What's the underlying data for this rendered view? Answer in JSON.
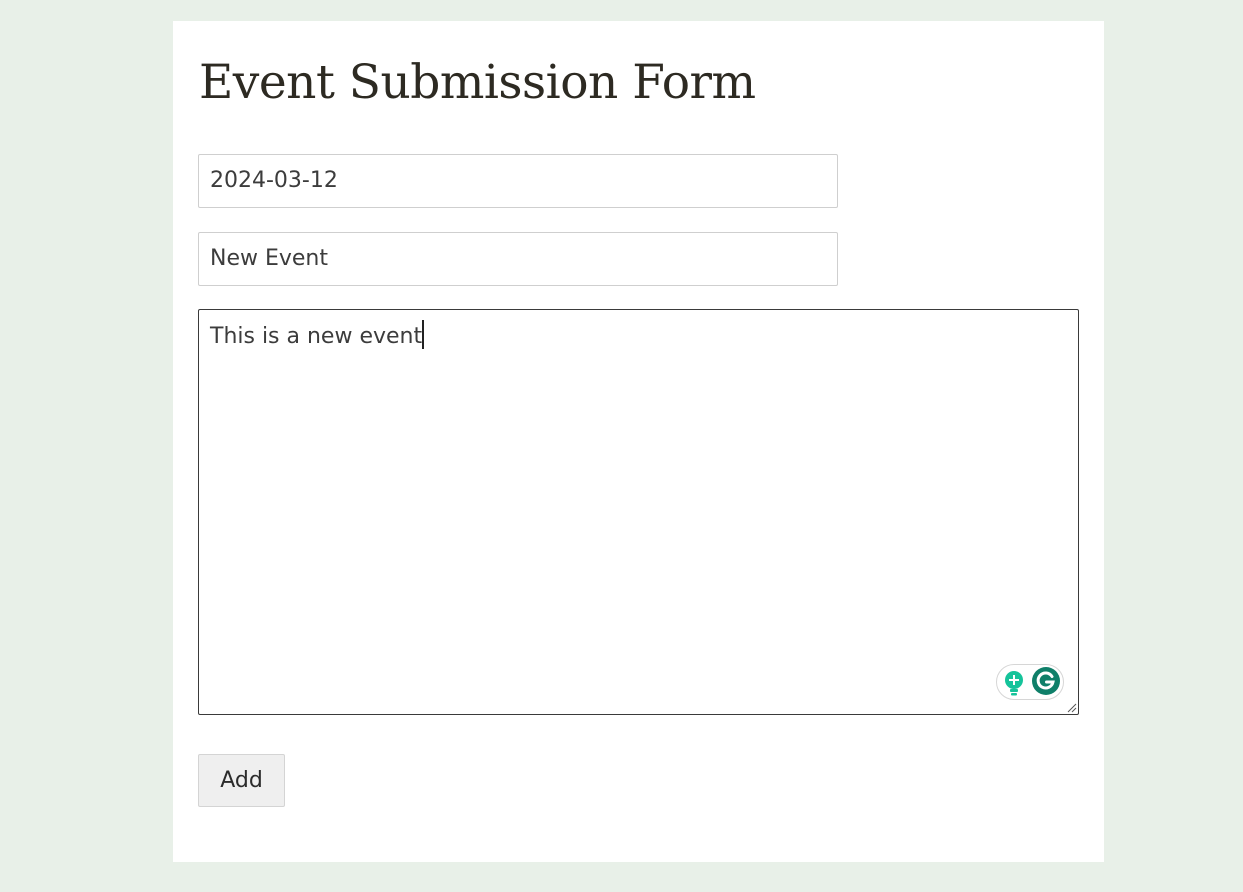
{
  "form": {
    "title": "Event Submission Form",
    "date_value": "2024-03-12",
    "name_value": "New Event",
    "description_value": "This is a new event",
    "submit_label": "Add"
  },
  "colors": {
    "background": "#e8f0e8",
    "card": "#ffffff",
    "title_text": "#2d2a22",
    "grammarly_green": "#15c39a",
    "grammarly_dark": "#0f7f69"
  },
  "icons": {
    "assist": "lightbulb-icon",
    "grammarly": "grammarly-icon",
    "resize": "resize-handle-icon"
  }
}
